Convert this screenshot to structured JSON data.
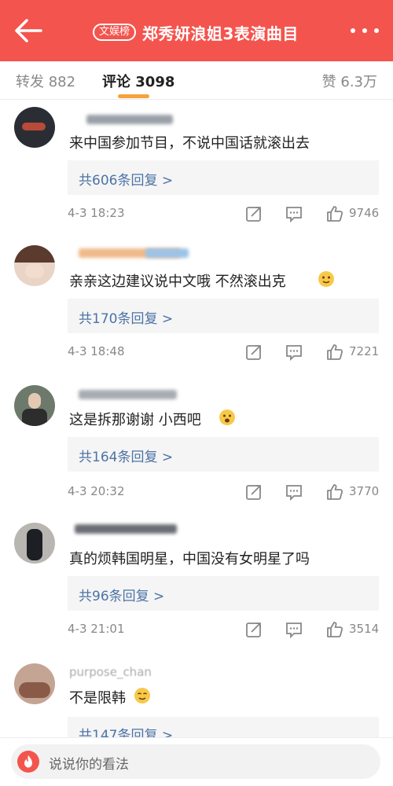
{
  "header": {
    "tag": "文娱榜",
    "title": "郑秀妍浪姐3表演曲目"
  },
  "tabs": {
    "repost": "转发 882",
    "comment": "评论 3098",
    "like": "赞 6.3万"
  },
  "comments": [
    {
      "text": "来中国参加节目，不说中国话就滚出去",
      "replies": "共606条回复 >",
      "time": "4-3 18:23",
      "likes": "9746"
    },
    {
      "text": "亲亲这边建议说中文哦 不然滚出克",
      "replies": "共170条回复 >",
      "time": "4-3 18:48",
      "likes": "7221"
    },
    {
      "text": "这是拆那谢谢 小西吧",
      "replies": "共164条回复 >",
      "time": "4-3 20:32",
      "likes": "3770"
    },
    {
      "text": "真的烦韩国明星，中国没有女明星了吗",
      "replies": "共96条回复 >",
      "time": "4-3 21:01",
      "likes": "3514"
    },
    {
      "text": "不是限韩",
      "replies": "共147条回复 >",
      "username": "purpose_chan"
    }
  ],
  "input": {
    "placeholder": "说说你的看法"
  },
  "icons": {
    "back": "back-arrow-icon",
    "more": "more-dots-icon",
    "share": "share-icon",
    "reply": "comment-icon",
    "like": "thumbs-up-icon",
    "fire": "fire-icon"
  },
  "colors": {
    "header": "#f4544e",
    "link": "#4c73a6",
    "underline": "#f7a23b"
  }
}
